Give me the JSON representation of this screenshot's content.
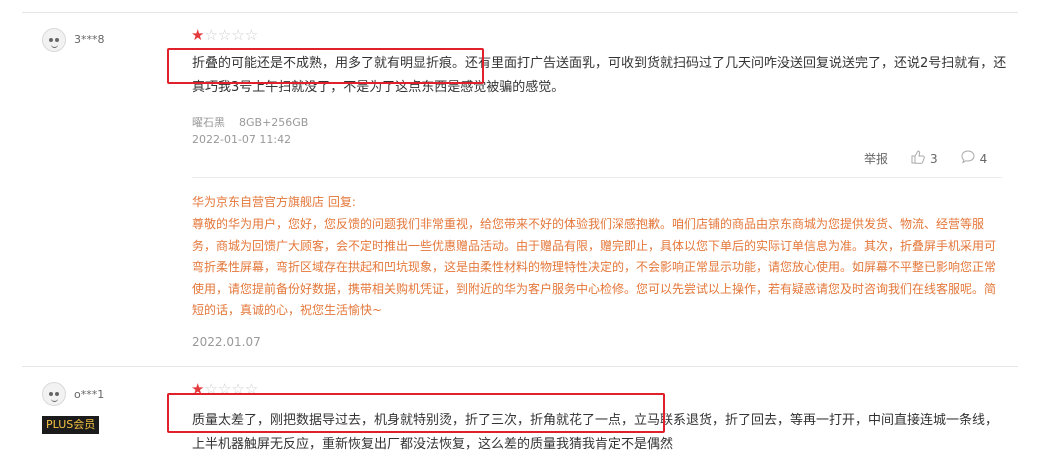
{
  "reviews": [
    {
      "username": "3***8",
      "rating": 1,
      "content": "折叠的可能还是不成熟，用多了就有明显折痕。还有里面打广告送面乳，可收到货就扫码过了几天问咋没送回复说送完了，还说2号扫就有，还真巧我3号上午扫就没了，不是为了这点东西是感觉被骗的感觉。",
      "variant": "曜石黑",
      "spec": "8GB+256GB",
      "datetime": "2022-01-07 11:42",
      "report_label": "举报",
      "likes": "3",
      "comments": "4",
      "reply_header": "华为京东自营官方旗舰店 回复:",
      "reply_body": "尊敬的华为用户，您好，您反馈的问题我们非常重视，给您带来不好的体验我们深感抱歉。咱们店铺的商品由京东商城为您提供发货、物流、经营等服务，商城为回馈广大顾客，会不定时推出一些优惠赠品活动。由于赠品有限，赠完即止，具体以您下单后的实际订单信息为准。其次，折叠屏手机采用可弯折柔性屏幕，弯折区域存在拱起和凹坑现象，这是由柔性材料的物理特性决定的，不会影响正常显示功能，请您放心使用。如屏幕不平整已影响您正常使用，请您提前备份好数据，携带相关购机凭证，到附近的华为客户服务中心检修。您可以先尝试以上操作，若有疑惑请您及时咨询我们在线客服呢。简短的话，真诚的心，祝您生活愉快~",
      "reply_date": "2022.01.07"
    },
    {
      "username": "o***1",
      "badge": "PLUS会员",
      "rating": 1,
      "content": "质量太差了，刚把数据导过去，机身就特别烫，折了三次，折角就花了一点，立马联系退货，折了回去，等再一打开，中间直接连城一条线，上半机器触屏无反应，重新恢复出厂都没法恢复，这么差的质量我猜我肯定不是偶然"
    }
  ],
  "colors": {
    "accent": "#e4393c",
    "reply": "#e4773a",
    "highlight_box": "#e0202a"
  },
  "icons": [
    "avatar-face",
    "star",
    "thumbs-up-icon",
    "comment-icon"
  ]
}
